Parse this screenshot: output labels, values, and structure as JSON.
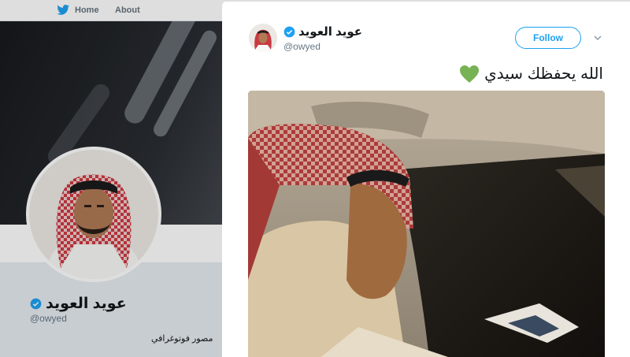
{
  "nav": {
    "home_label": "Home",
    "about_label": "About"
  },
  "profile": {
    "name": "عويد العويد",
    "handle": "@owyed",
    "bio": "مصور فوتوغرافي"
  },
  "tweet": {
    "author_name": "عويد العويد",
    "author_handle": "@owyed",
    "follow_label": "Follow",
    "text": "الله يحفظك سيدي",
    "emoji": "green-heart-icon"
  },
  "colors": {
    "accent": "#1da1f2",
    "verified": "#1da1f2",
    "heart": "#77b255"
  }
}
